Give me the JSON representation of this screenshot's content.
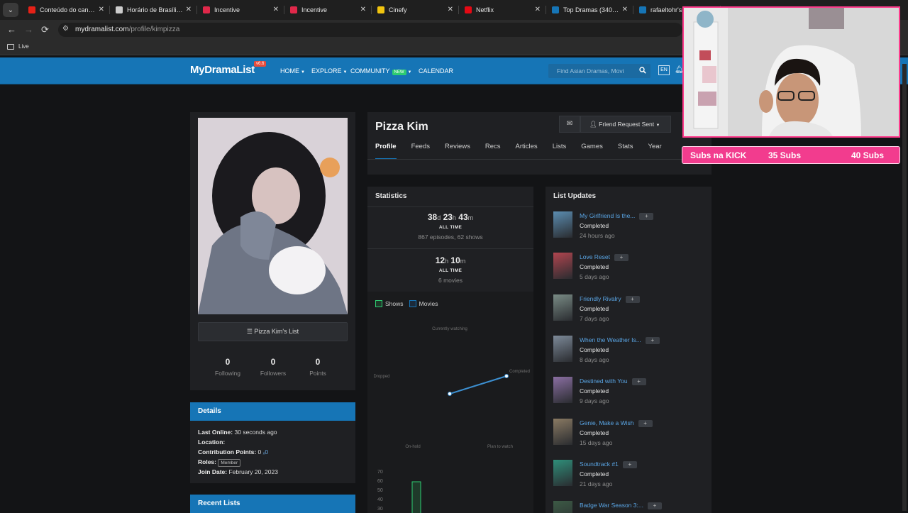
{
  "browser": {
    "tabs": [
      {
        "title": "Conteúdo do canal -",
        "icon": "youtube-icon",
        "color": "#e62117"
      },
      {
        "title": "Horário de Brasília - ",
        "icon": "globe-icon",
        "color": "#cccccc"
      },
      {
        "title": "Incentive",
        "icon": "incentive-icon",
        "color": "#e0284a"
      },
      {
        "title": "Incentive",
        "icon": "incentive-icon",
        "color": "#e0284a"
      },
      {
        "title": "Cinefy",
        "icon": "cinefy-icon",
        "color": "#f1c40f"
      },
      {
        "title": "Netflix",
        "icon": "netflix-icon",
        "color": "#e50914"
      },
      {
        "title": "Top Dramas (340 of 5",
        "icon": "mdl-icon",
        "color": "#1675b6"
      },
      {
        "title": "rafaeltohr's Pro",
        "icon": "mdl-icon",
        "color": "#1675b6"
      }
    ],
    "url_host": "mydramalist.com",
    "url_path": "/profile/kimpizza",
    "bookmark": "Live"
  },
  "site": {
    "logo": "MyDramaList",
    "version": "v6.6",
    "nav": {
      "home": "HOME",
      "explore": "EXPLORE",
      "community": "COMMUNITY",
      "new_badge": "NEW",
      "calendar": "CALENDAR"
    },
    "search_placeholder": "Find Asian Dramas, Movi",
    "lang": "EN"
  },
  "profile": {
    "name": "Pizza Kim",
    "friend_button": "Friend Request Sent",
    "tabs": [
      "Profile",
      "Feeds",
      "Reviews",
      "Recs",
      "Articles",
      "Lists",
      "Games",
      "Stats",
      "Year"
    ],
    "list_button": "Pizza Kim's List",
    "following": {
      "value": "0",
      "label": "Following"
    },
    "followers": {
      "value": "0",
      "label": "Followers"
    },
    "points": {
      "value": "0",
      "label": "Points"
    }
  },
  "details": {
    "title": "Details",
    "last_online_label": "Last Online:",
    "last_online": "30 seconds ago",
    "location_label": "Location:",
    "contribution_label": "Contribution Points:",
    "contribution_value": "0",
    "contribution_link": "ₓ0",
    "roles_label": "Roles:",
    "role": "Member",
    "join_label": "Join Date:",
    "join_date": "February 20, 2023"
  },
  "recent_lists": {
    "title": "Recent Lists"
  },
  "statistics": {
    "title": "Statistics",
    "shows_time": {
      "d": "38",
      "h": "23",
      "m": "43"
    },
    "all_time_label": "ALL TIME",
    "shows_sub": "867 episodes, 62 shows",
    "movies_time": {
      "h": "12",
      "m": "10"
    },
    "movies_sub": "6 movies",
    "legend": {
      "shows": "Shows",
      "movies": "Movies"
    },
    "shows_color": "#2ecc71",
    "movies_color": "#1675b6"
  },
  "chart_data": {
    "type": "radar",
    "axes": [
      "Currently watching",
      "Completed",
      "Plan to watch",
      "On-hold",
      "Dropped"
    ],
    "bar_ticks": [
      "70",
      "60",
      "50",
      "40",
      "30"
    ]
  },
  "updates": {
    "title": "List Updates",
    "items": [
      {
        "title": "My Girlfriend Is the...",
        "status": "Completed",
        "time": "24 hours ago"
      },
      {
        "title": "Love Reset",
        "status": "Completed",
        "time": "5 days ago"
      },
      {
        "title": "Friendly Rivalry",
        "status": "Completed",
        "time": "7 days ago"
      },
      {
        "title": "When the Weather Is...",
        "status": "Completed",
        "time": "8 days ago"
      },
      {
        "title": "Destined with You",
        "status": "Completed",
        "time": "9 days ago"
      },
      {
        "title": "Genie, Make a Wish",
        "status": "Completed",
        "time": "15 days ago"
      },
      {
        "title": "Soundtrack #1",
        "status": "Completed",
        "time": "21 days ago"
      },
      {
        "title": "Badge War Season 3:...",
        "status": "",
        "time": ""
      }
    ]
  },
  "overlay": {
    "left": "Subs na KICK",
    "mid": "35 Subs",
    "right": "40 Subs",
    "accent": "#f23c8e"
  }
}
